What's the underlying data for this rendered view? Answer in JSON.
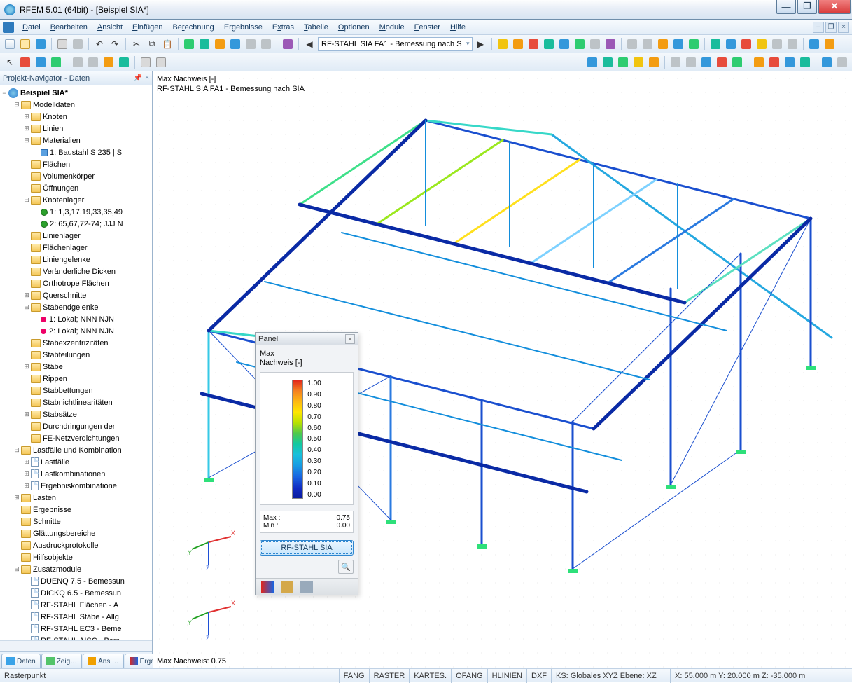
{
  "title": "RFEM 5.01 (64bit) - [Beispiel SIA*]",
  "menu": [
    "Datei",
    "Bearbeiten",
    "Ansicht",
    "Einfügen",
    "Berechnung",
    "Ergebnisse",
    "Extras",
    "Tabelle",
    "Optionen",
    "Module",
    "Fenster",
    "Hilfe"
  ],
  "combo_module": "RF-STAHL SIA FA1 - Bemessung nach S",
  "nav": {
    "title": "Projekt-Navigator - Daten",
    "root": "Beispiel SIA*",
    "items": [
      {
        "ind": 1,
        "exp": "-",
        "icon": "fold",
        "label": "Modelldaten"
      },
      {
        "ind": 2,
        "exp": "+",
        "icon": "fold",
        "label": "Knoten"
      },
      {
        "ind": 2,
        "exp": "+",
        "icon": "fold",
        "label": "Linien"
      },
      {
        "ind": 2,
        "exp": "-",
        "icon": "fold",
        "label": "Materialien"
      },
      {
        "ind": 3,
        "exp": "",
        "icon": "square",
        "label": "1: Baustahl S 235 | S"
      },
      {
        "ind": 2,
        "exp": "",
        "icon": "fold",
        "label": "Flächen"
      },
      {
        "ind": 2,
        "exp": "",
        "icon": "fold",
        "label": "Volumenkörper"
      },
      {
        "ind": 2,
        "exp": "",
        "icon": "fold",
        "label": "Öffnungen"
      },
      {
        "ind": 2,
        "exp": "-",
        "icon": "fold",
        "label": "Knotenlager"
      },
      {
        "ind": 3,
        "exp": "",
        "icon": "pin",
        "label": "1: 1,3,17,19,33,35,49"
      },
      {
        "ind": 3,
        "exp": "",
        "icon": "pin",
        "label": "2: 65,67,72-74; JJJ N"
      },
      {
        "ind": 2,
        "exp": "",
        "icon": "fold",
        "label": "Linienlager"
      },
      {
        "ind": 2,
        "exp": "",
        "icon": "fold",
        "label": "Flächenlager"
      },
      {
        "ind": 2,
        "exp": "",
        "icon": "fold",
        "label": "Liniengelenke"
      },
      {
        "ind": 2,
        "exp": "",
        "icon": "fold",
        "label": "Veränderliche Dicken"
      },
      {
        "ind": 2,
        "exp": "",
        "icon": "fold",
        "label": "Orthotrope Flächen"
      },
      {
        "ind": 2,
        "exp": "+",
        "icon": "fold",
        "label": "Querschnitte"
      },
      {
        "ind": 2,
        "exp": "-",
        "icon": "fold",
        "label": "Stabendgelenke"
      },
      {
        "ind": 3,
        "exp": "",
        "icon": "dot",
        "label": "1: Lokal; NNN NJN"
      },
      {
        "ind": 3,
        "exp": "",
        "icon": "dot",
        "label": "2: Lokal; NNN NJN"
      },
      {
        "ind": 2,
        "exp": "",
        "icon": "fold",
        "label": "Stabexzentrizitäten"
      },
      {
        "ind": 2,
        "exp": "",
        "icon": "fold",
        "label": "Stabteilungen"
      },
      {
        "ind": 2,
        "exp": "+",
        "icon": "fold",
        "label": "Stäbe"
      },
      {
        "ind": 2,
        "exp": "",
        "icon": "fold",
        "label": "Rippen"
      },
      {
        "ind": 2,
        "exp": "",
        "icon": "fold",
        "label": "Stabbettungen"
      },
      {
        "ind": 2,
        "exp": "",
        "icon": "fold",
        "label": "Stabnichtlinearitäten"
      },
      {
        "ind": 2,
        "exp": "+",
        "icon": "fold",
        "label": "Stabsätze"
      },
      {
        "ind": 2,
        "exp": "",
        "icon": "fold",
        "label": "Durchdringungen der"
      },
      {
        "ind": 2,
        "exp": "",
        "icon": "fold",
        "label": "FE-Netzverdichtungen"
      },
      {
        "ind": 1,
        "exp": "-",
        "icon": "fold",
        "label": "Lastfälle und Kombination"
      },
      {
        "ind": 2,
        "exp": "+",
        "icon": "doc",
        "label": "Lastfälle"
      },
      {
        "ind": 2,
        "exp": "+",
        "icon": "doc",
        "label": "Lastkombinationen"
      },
      {
        "ind": 2,
        "exp": "+",
        "icon": "doc",
        "label": "Ergebniskombinatione"
      },
      {
        "ind": 1,
        "exp": "+",
        "icon": "fold",
        "label": "Lasten"
      },
      {
        "ind": 1,
        "exp": "",
        "icon": "fold",
        "label": "Ergebnisse"
      },
      {
        "ind": 1,
        "exp": "",
        "icon": "fold",
        "label": "Schnitte"
      },
      {
        "ind": 1,
        "exp": "",
        "icon": "fold",
        "label": "Glättungsbereiche"
      },
      {
        "ind": 1,
        "exp": "",
        "icon": "fold",
        "label": "Ausdruckprotokolle"
      },
      {
        "ind": 1,
        "exp": "",
        "icon": "fold",
        "label": "Hilfsobjekte"
      },
      {
        "ind": 1,
        "exp": "-",
        "icon": "fold",
        "label": "Zusatzmodule"
      },
      {
        "ind": 2,
        "exp": "",
        "icon": "doc",
        "label": "DUENQ 7.5 - Bemessun"
      },
      {
        "ind": 2,
        "exp": "",
        "icon": "doc",
        "label": "DICKQ 6.5 - Bemessun"
      },
      {
        "ind": 2,
        "exp": "",
        "icon": "doc",
        "label": "RF-STAHL Flächen - A"
      },
      {
        "ind": 2,
        "exp": "",
        "icon": "doc",
        "label": "RF-STAHL Stäbe - Allg"
      },
      {
        "ind": 2,
        "exp": "",
        "icon": "doc",
        "label": "RF-STAHL EC3 - Beme"
      },
      {
        "ind": 2,
        "exp": "",
        "icon": "doc",
        "label": "RF-STAHL AISC - Bem"
      }
    ],
    "tabs": [
      "Daten",
      "Zeig…",
      "Ansi…",
      "Erge…"
    ]
  },
  "viewport": {
    "line1": "Max Nachweis [-]",
    "line2": "RF-STAHL SIA FA1 - Bemessung nach SIA",
    "bottom": "Max Nachweis: 0.75"
  },
  "panel": {
    "title": "Panel",
    "sub1": "Max",
    "sub2": "Nachweis [-]",
    "ticks": [
      "1.00",
      "0.90",
      "0.80",
      "0.70",
      "0.60",
      "0.50",
      "0.40",
      "0.30",
      "0.20",
      "0.10",
      "0.00"
    ],
    "max_l": "Max :",
    "max_v": "0.75",
    "min_l": "Min  :",
    "min_v": "0.00",
    "button": "RF-STAHL SIA"
  },
  "status": {
    "left": "Rasterpunkt",
    "segs": [
      "FANG",
      "RASTER",
      "KARTES.",
      "OFANG",
      "HLINIEN",
      "DXF"
    ],
    "ks": "KS: Globales XYZ Ebene: XZ",
    "coords": "X: 55.000 m   Y: 20.000 m   Z: -35.000 m"
  },
  "chart_data": {
    "type": "table",
    "title": "Color scale – Max Nachweis [-]",
    "range": [
      0.0,
      1.0
    ],
    "ticks": [
      1.0,
      0.9,
      0.8,
      0.7,
      0.6,
      0.5,
      0.4,
      0.3,
      0.2,
      0.1,
      0.0
    ],
    "max": 0.75,
    "min": 0.0,
    "result_label": "RF-STAHL SIA FA1 - Bemessung nach SIA"
  }
}
